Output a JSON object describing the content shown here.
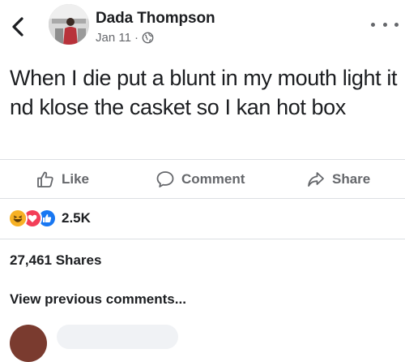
{
  "post": {
    "author": "Dada Thompson",
    "date": "Jan 11",
    "meta_separator": "·",
    "text": "When I die put a blunt in my mouth light it nd klose the casket so I kan hot box"
  },
  "actions": {
    "like": "Like",
    "comment": "Comment",
    "share": "Share"
  },
  "reactions": {
    "types": [
      "haha",
      "love",
      "like"
    ],
    "count": "2.5K"
  },
  "shares_text": "27,461 Shares",
  "view_previous": "View previous comments...",
  "icons": {
    "back": "chevron-left-icon",
    "more": "more-dots-icon",
    "privacy": "globe-icon",
    "like": "thumbs-up-icon",
    "comment": "speech-bubble-icon",
    "share": "share-arrow-icon"
  },
  "colors": {
    "text": "#1c1e21",
    "secondary": "#65676b",
    "like_blue": "#1877f2",
    "love_red": "#f33e58",
    "haha_yellow": "#f7b125"
  }
}
